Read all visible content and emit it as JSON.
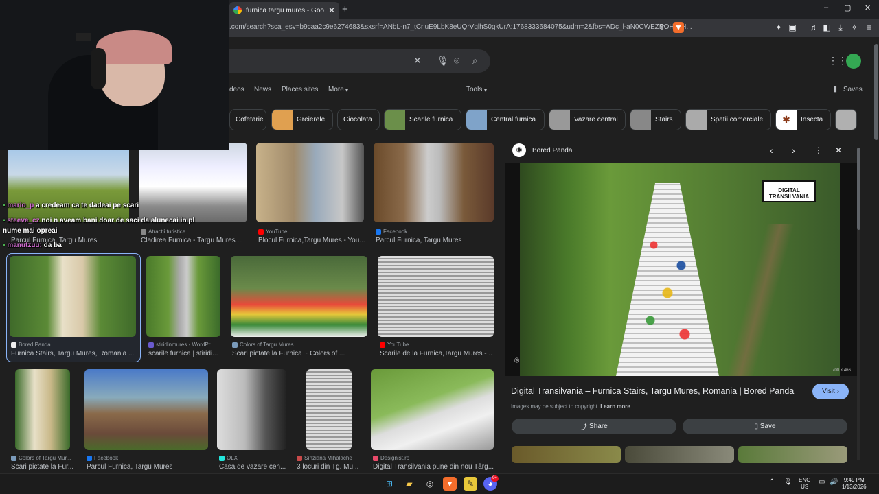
{
  "browser": {
    "tab_title": "furnica targu mures - Google Se",
    "url": ".com/search?sca_esv=b9caa2c9e6274683&sxsrf=ANbL-n7_tCrluE9LbK8eUQrVglhS0gkUrA:1768333684075&udm=2&fbs=ADc_l-aN0CWEZBOHjofH...",
    "window_controls": [
      "–",
      "▢",
      "✕"
    ]
  },
  "google": {
    "nav": [
      "deos",
      "News",
      "Places sites",
      "More",
      "Tools"
    ],
    "saves": "Saves",
    "chips": [
      "Cofetarie",
      "Greierele",
      "Ciocolata",
      "Scarile furnica",
      "Central furnica",
      "Vazare central",
      "Stairs",
      "Spatii comerciale",
      "Insecta"
    ]
  },
  "results": [
    {
      "source": "",
      "caption": "Parcul Furnica, Targu Mures"
    },
    {
      "source": "Atractii turistice",
      "caption": "Cladirea Furnica - Targu Mures ..."
    },
    {
      "source": "YouTube",
      "caption": "Blocul Furnica,Targu Mures - You..."
    },
    {
      "source": "Facebook",
      "caption": "Parcul Furnica, Targu Mures"
    },
    {
      "source": "Bored Panda",
      "caption": "Furnica Stairs, Targu Mures, Romania ..."
    },
    {
      "source": "stiridinmures - WordPr...",
      "caption": "scarile furnica | stiridi..."
    },
    {
      "source": "Colors of Targu Mures",
      "caption": "Scari pictate la Furnica ~ Colors of ..."
    },
    {
      "source": "YouTube",
      "caption": "Scarile de la Furnica,Targu Mures - ..."
    },
    {
      "source": "Colors of Targu Mur...",
      "caption": "Scari pictate la Fur..."
    },
    {
      "source": "Facebook",
      "caption": "Parcul Furnica, Targu Mures"
    },
    {
      "source": "OLX",
      "caption": "Casa de vazare cen..."
    },
    {
      "source": "Sînziana Mihalache",
      "caption": "3 locuri din Tg. Mu..."
    },
    {
      "source": "Designist.ro",
      "caption": "Digital Transilvania pune din nou Târg..."
    }
  ],
  "panel": {
    "source": "Bored Panda",
    "title": "Digital Transilvania – Furnica Stairs, Targu Mures, Romania | Bored Panda",
    "visit": "Visit",
    "copyright": "Images may be subject to copyright.",
    "learn_more": "Learn more",
    "share": "Share",
    "save": "Save",
    "dims": "700 × 466",
    "watermark": "DIGITAL TRANSILVANIA"
  },
  "chat": [
    {
      "user": "mario_p",
      "text": "a credeam ca te dadeai pe scari"
    },
    {
      "user": "steeve_cz",
      "text": "noi n aveam bani doar de saci da alunecai in pl"
    },
    {
      "user": "",
      "text": "nume mai opreai"
    },
    {
      "user": "manutzuu:",
      "text": "da ba"
    }
  ],
  "taskbar": {
    "lang": "ENG",
    "region": "US",
    "time": "9:49 PM",
    "date": "1/13/2026",
    "badge": "9+"
  }
}
